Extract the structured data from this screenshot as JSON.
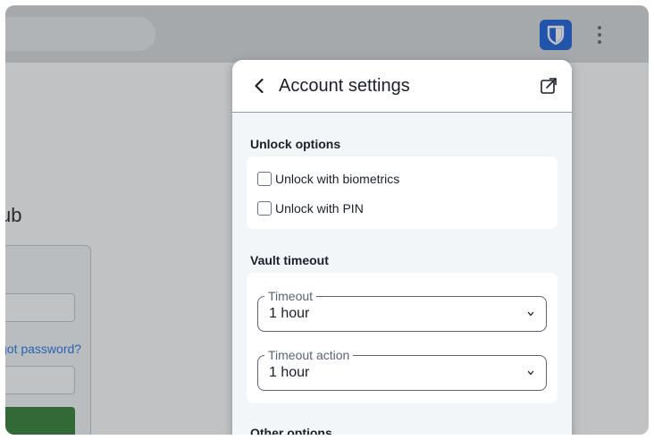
{
  "colors": {
    "accent": "#175ddc",
    "browser_bar": "#d8dade",
    "popup_background": "#f3f6f9",
    "link": "#1a73e8",
    "login_button": "#2e7d32"
  },
  "browser": {
    "extension_icon": "bitwarden-shield-icon",
    "menu_icon": "kebab-menu-icon"
  },
  "page": {
    "title_fragment": "ub",
    "forgot_link": "got password?"
  },
  "popup": {
    "back_icon": "chevron-left-icon",
    "title": "Account settings",
    "popout_icon": "popout-icon",
    "unlock_options": {
      "title": "Unlock options",
      "items": [
        {
          "label": "Unlock with biometrics",
          "checked": false
        },
        {
          "label": "Unlock with PIN",
          "checked": false
        }
      ]
    },
    "vault_timeout": {
      "title": "Vault timeout",
      "timeout": {
        "label": "Timeout",
        "value": "1 hour"
      },
      "timeout_action": {
        "label": "Timeout action",
        "value": "1 hour"
      }
    },
    "other_options": {
      "title": "Other options"
    }
  }
}
